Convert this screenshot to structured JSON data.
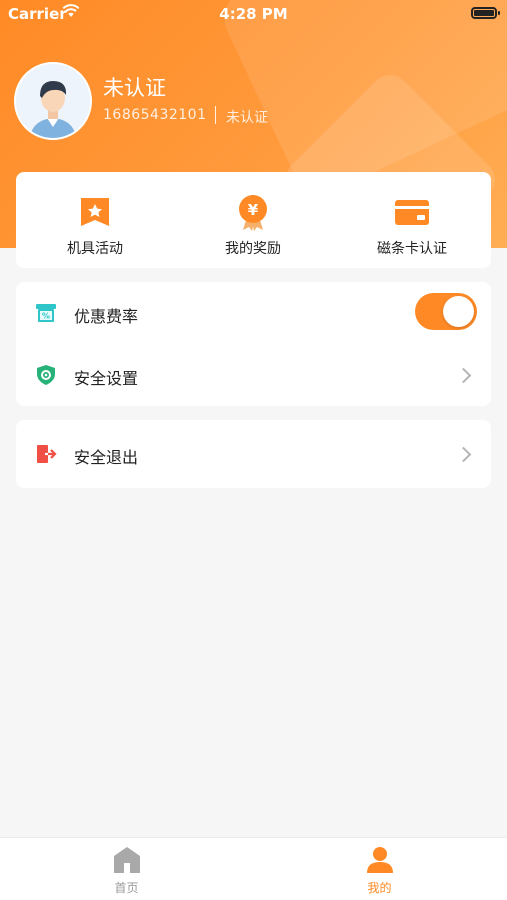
{
  "status_bar": {
    "carrier": "Carrier",
    "time": "4:28 PM"
  },
  "profile": {
    "name": "未认证",
    "phone": "16865432101",
    "auth_status": "未认证"
  },
  "quick_actions": [
    {
      "label": "机具活动",
      "icon": "bookmark-star-icon"
    },
    {
      "label": "我的奖励",
      "icon": "yuan-medal-icon"
    },
    {
      "label": "磁条卡认证",
      "icon": "card-icon"
    }
  ],
  "settings": {
    "discount_rate": {
      "label": "优惠费率",
      "icon": "ticket-percent-icon",
      "enabled": true
    },
    "security": {
      "label": "安全设置",
      "icon": "shield-gear-icon"
    }
  },
  "logout": {
    "label": "安全退出",
    "icon": "exit-door-icon"
  },
  "tabbar": {
    "home": {
      "label": "首页",
      "icon": "home-icon",
      "active": false
    },
    "mine": {
      "label": "我的",
      "icon": "person-icon",
      "active": true
    }
  },
  "colors": {
    "accent": "#ff8a25",
    "inactive": "#9a9a9a",
    "teal": "#2fc6c9",
    "green": "#27b27a",
    "red": "#f04f45"
  }
}
